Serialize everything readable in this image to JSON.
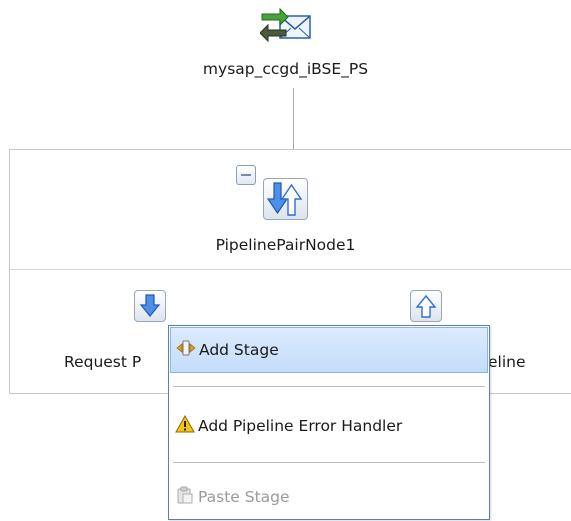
{
  "proxy_service": {
    "label": "mysap_ccgd_iBSE_PS",
    "icon": "proxy-service-exchange-icon"
  },
  "pipeline_pair": {
    "label": "PipelinePairNode1",
    "icon": "pipeline-pair-icon",
    "collapse_icon": "collapse-icon"
  },
  "request_pipeline": {
    "label_visible": "Request P",
    "icon": "request-pipeline-down-arrow-icon"
  },
  "response_pipeline": {
    "label_visible": "eline",
    "icon": "response-pipeline-up-arrow-icon"
  },
  "context_menu": {
    "items": [
      {
        "label": "Add Stage",
        "icon": "add-stage-icon",
        "highlighted": true,
        "enabled": true
      },
      {
        "label": "Add Pipeline Error Handler",
        "icon": "warning-icon",
        "highlighted": false,
        "enabled": true
      },
      {
        "label": "Paste Stage",
        "icon": "paste-icon",
        "highlighted": false,
        "enabled": false
      }
    ]
  },
  "colors": {
    "menu_border": "#5a7fb8",
    "highlight_bg": "#c4dcfa",
    "arrow_blue": "#2e6fd0",
    "disabled_text": "#9a9a9a"
  }
}
